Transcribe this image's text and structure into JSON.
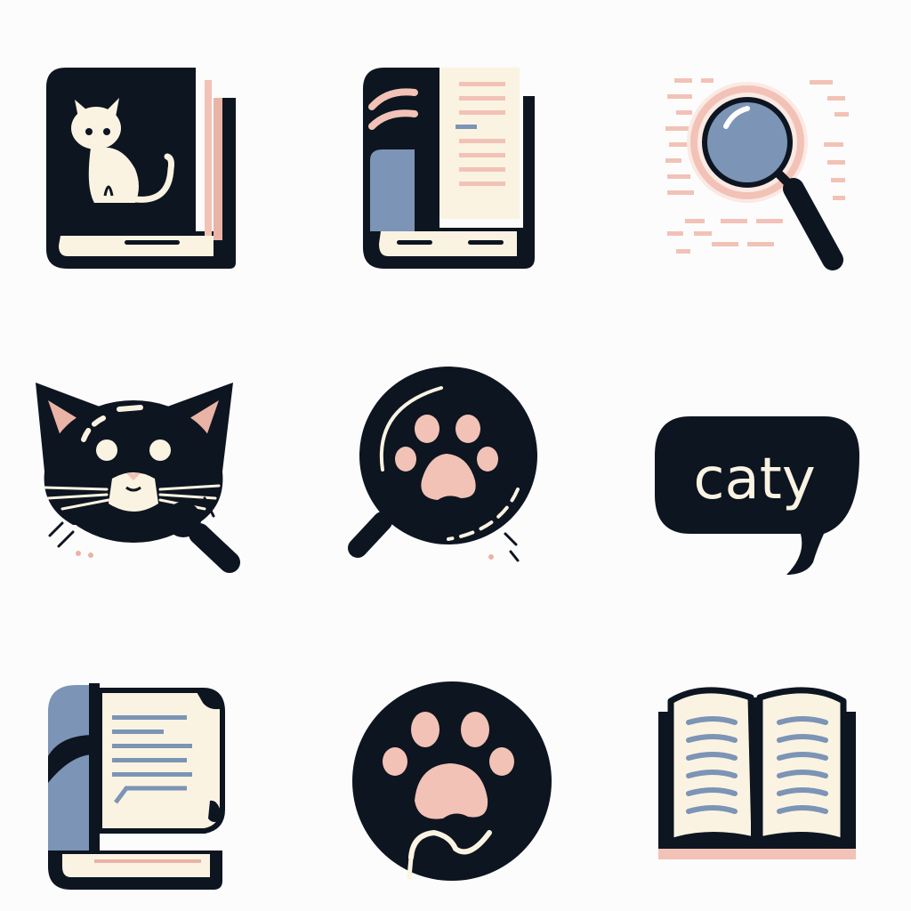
{
  "icon_set": {
    "colors": {
      "ink": "#0d1520",
      "cream": "#fbf3e2",
      "blush": "#f2c2b6",
      "pink": "#e9b3a6",
      "slate_blue": "#7c94b5",
      "background": "#fdfcfc"
    },
    "icons": [
      {
        "name": "cat-book-icon"
      },
      {
        "name": "book-icon"
      },
      {
        "name": "magnifier-search-icon"
      },
      {
        "name": "cat-face-magnifier-icon"
      },
      {
        "name": "paw-magnifier-icon"
      },
      {
        "name": "caty-speech-bubble-icon",
        "text": "caty"
      },
      {
        "name": "document-book-icon"
      },
      {
        "name": "paw-circle-icon"
      },
      {
        "name": "open-book-icon"
      }
    ]
  }
}
